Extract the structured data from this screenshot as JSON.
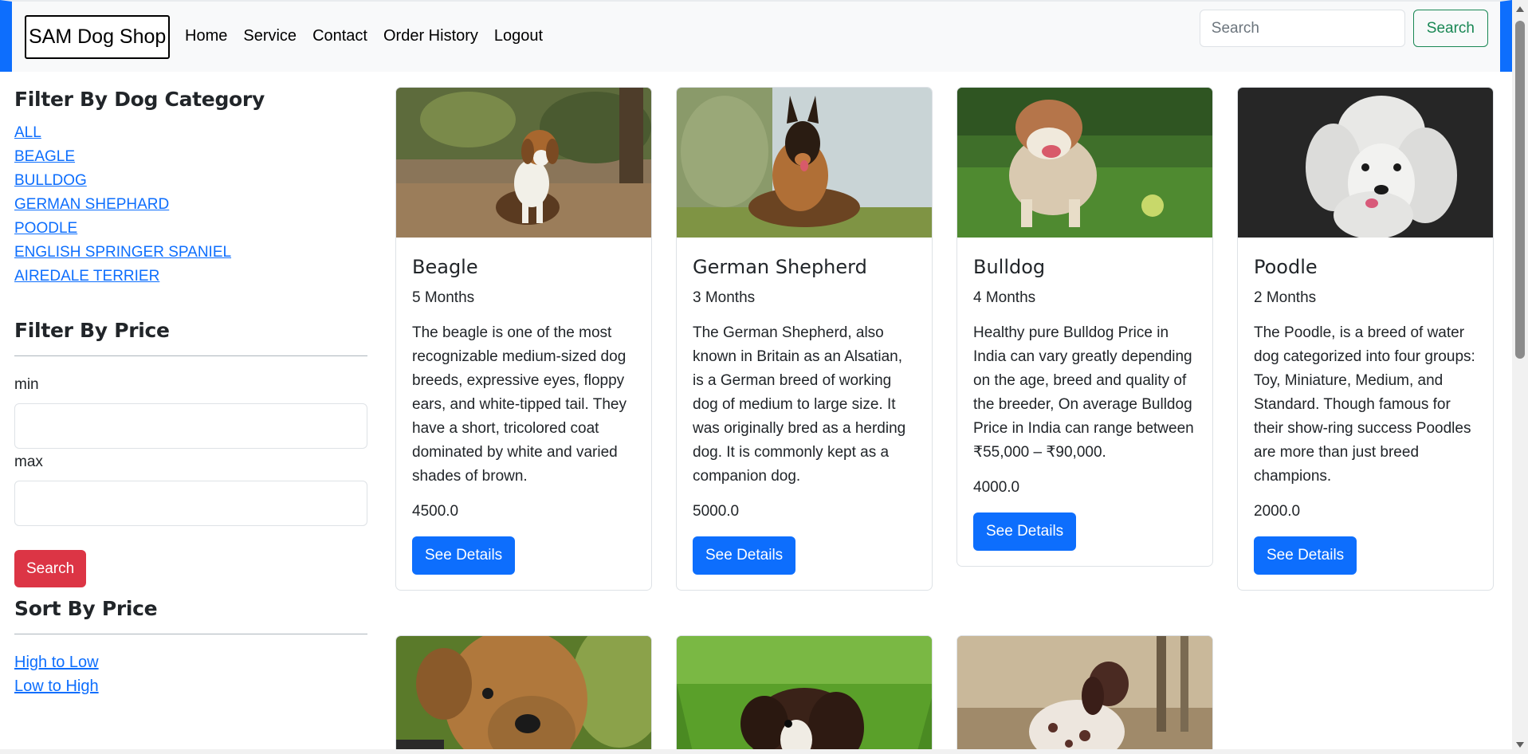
{
  "navbar": {
    "brand": "SAM Dog Shop",
    "links": [
      "Home",
      "Service",
      "Contact",
      "Order History",
      "Logout"
    ],
    "search_placeholder": "Search",
    "search_button": "Search"
  },
  "sidebar": {
    "category_heading": "Filter By Dog Category",
    "categories": [
      "ALL",
      "BEAGLE",
      "BULLDOG",
      "GERMAN SHEPHARD",
      "POODLE",
      "ENGLISH SPRINGER SPANIEL",
      "AIREDALE TERRIER"
    ],
    "price_heading": "Filter By Price",
    "min_label": "min",
    "max_label": "max",
    "price_search_button": "Search",
    "sort_heading": "Sort By Price",
    "sort_options": [
      "High to Low",
      "Low to High"
    ]
  },
  "cards": [
    {
      "title": "Beagle",
      "age": "5 Months",
      "description": "The beagle is one of the most recognizable medium-sized dog breeds, expressive eyes, floppy ears, and white-tipped tail. They have a short, tricolored coat dominated by white and varied shades of brown.",
      "price": "4500.0",
      "button": "See Details"
    },
    {
      "title": "German Shepherd",
      "age": "3 Months",
      "description": "The German Shepherd, also known in Britain as an Alsatian, is a German breed of working dog of medium to large size. It was originally bred as a herding dog. It is commonly kept as a companion dog.",
      "price": "5000.0",
      "button": "See Details"
    },
    {
      "title": "Bulldog",
      "age": "4 Months",
      "description": "Healthy pure Bulldog Price in India can vary greatly depending on the age, breed and quality of the breeder, On average Bulldog Price in India can range between ₹55,000 – ₹90,000.",
      "price": "4000.0",
      "button": "See Details"
    },
    {
      "title": "Poodle",
      "age": "2 Months",
      "description": "The Poodle, is a breed of water dog categorized into four groups: Toy, Miniature, Medium, and Standard. Though famous for their show-ring success Poodles are more than just breed champions.",
      "price": "2000.0",
      "button": "See Details"
    }
  ],
  "colors": {
    "primary": "#0d6efd",
    "danger": "#dc3545",
    "success": "#198754",
    "navbar_bg": "#f8f9fa"
  }
}
